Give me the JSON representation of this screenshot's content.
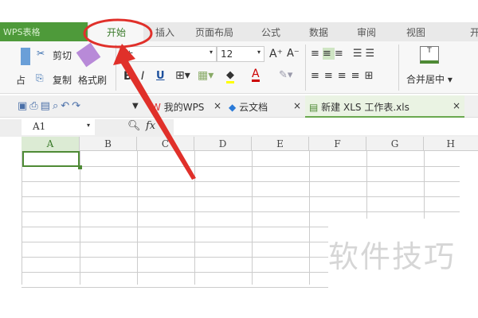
{
  "app_tab": "WPS表格",
  "ribbon_tabs": [
    "开始",
    "插入",
    "页面布局",
    "公式",
    "数据",
    "审阅",
    "视图",
    "开"
  ],
  "active_tab": "开始",
  "clipboard": {
    "cut": "剪切",
    "copy": "复制",
    "paste_suffix": "占",
    "format_painter": "格式刷"
  },
  "font": {
    "name": "体",
    "size": "12"
  },
  "buttons": {
    "bold": "B",
    "italic": "I",
    "underline": "U",
    "font_color": "A",
    "grow": "A⁺",
    "shrink": "A⁻",
    "merge_center": "合并居中"
  },
  "doc_tabs": [
    {
      "label": "我的WPS"
    },
    {
      "label": "云文档"
    },
    {
      "label": "新建 XLS 工作表.xls"
    }
  ],
  "close_glyph": "×",
  "name_box": "A1",
  "fx": "fx",
  "columns": [
    "A",
    "B",
    "C",
    "D",
    "E",
    "F",
    "G",
    "H"
  ],
  "watermark": "软件技巧",
  "colors": {
    "accent": "#4e8a35",
    "annotation": "#e0302a"
  }
}
